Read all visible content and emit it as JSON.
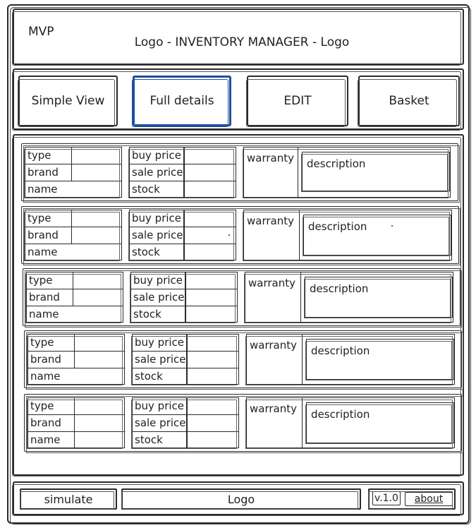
{
  "header": {
    "mvp": "MVP",
    "title": "Logo - INVENTORY MANAGER - Logo"
  },
  "nav": {
    "tabs": [
      {
        "label": "Simple View",
        "active": false
      },
      {
        "label": "Full details",
        "active": true
      },
      {
        "label": "EDIT",
        "active": false
      },
      {
        "label": "Basket",
        "active": false
      }
    ]
  },
  "item_fields": {
    "type": "type",
    "brand": "brand",
    "name": "name",
    "buy_price": "buy price",
    "sale_price": "sale price",
    "stock": "stock",
    "warranty": "warranty",
    "description": "description"
  },
  "items_count": 5,
  "footer": {
    "simulate": "simulate",
    "logo": "Logo",
    "version": "v.1.0",
    "about": "about"
  },
  "colors": {
    "active_tab": "#1f4e9c",
    "stroke": "#2a2a2a"
  }
}
